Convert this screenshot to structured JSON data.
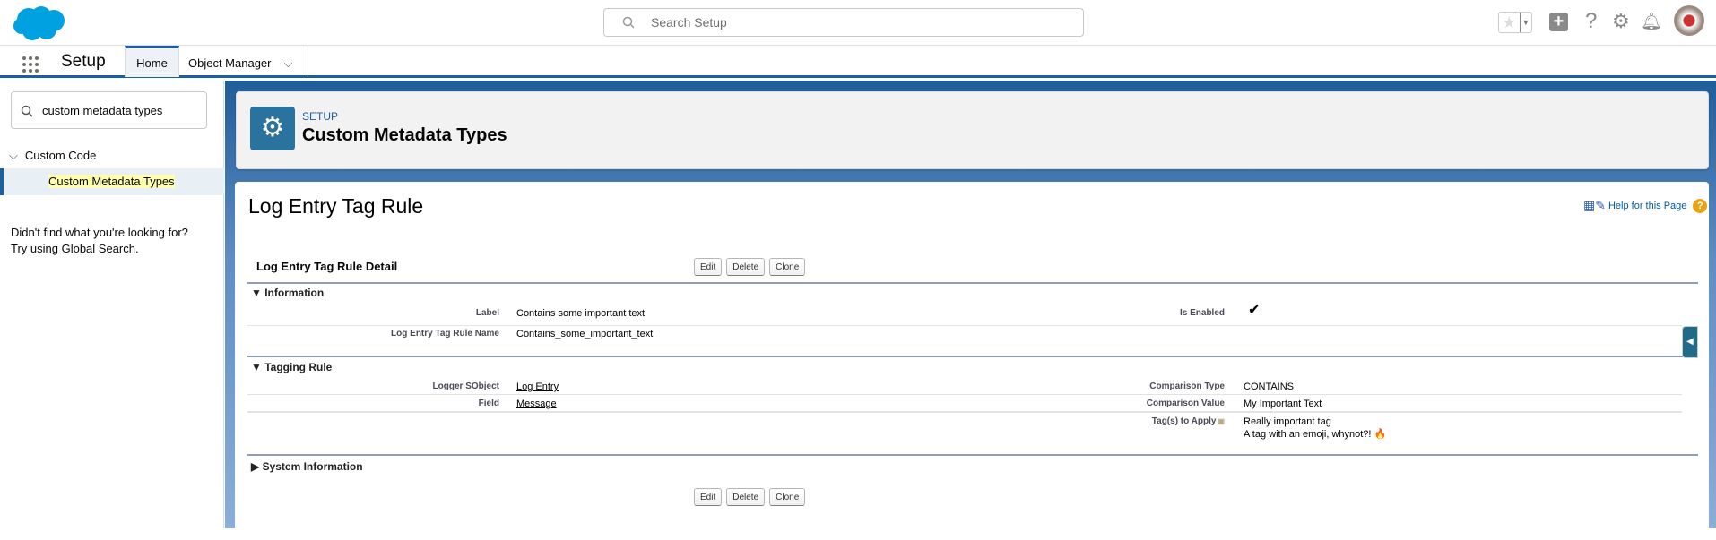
{
  "header": {
    "search_placeholder": "Search Setup",
    "icons": [
      "salesforce-logo",
      "favorites-star-icon",
      "favorites-dropdown-icon",
      "global-create-icon",
      "help-icon",
      "setup-gear-icon",
      "notifications-bell-icon",
      "user-avatar"
    ]
  },
  "nav": {
    "app_name": "Setup",
    "tabs": [
      {
        "label": "Home",
        "active": true
      },
      {
        "label": "Object Manager"
      }
    ]
  },
  "sidebar": {
    "search_value": "custom metadata types",
    "group": "Custom Code",
    "selected_item": "Custom Metadata Types",
    "not_found_line1": "Didn't find what you're looking for?",
    "not_found_line2": "Try using Global Search."
  },
  "page_header": {
    "eyebrow": "SETUP",
    "title": "Custom Metadata Types"
  },
  "record": {
    "title": "Log Entry Tag Rule",
    "help_link": "Help for this Page",
    "detail_title": "Log Entry Tag Rule Detail",
    "buttons": {
      "edit": "Edit",
      "delete": "Delete",
      "clone": "Clone"
    },
    "sections": {
      "information": {
        "title": "Information",
        "label_label": "Label",
        "label_value": "Contains some important text",
        "name_label": "Log Entry Tag Rule Name",
        "name_value": "Contains_some_important_text",
        "enabled_label": "Is Enabled",
        "enabled_value": true
      },
      "tagging": {
        "title": "Tagging Rule",
        "sobject_label": "Logger SObject",
        "sobject_value": "Log Entry",
        "field_label": "Field",
        "field_value": "Message",
        "ctype_label": "Comparison Type",
        "ctype_value": "CONTAINS",
        "cvalue_label": "Comparison Value",
        "cvalue_value": "My Important Text",
        "tags_label": "Tag(s) to Apply",
        "tags": [
          "Really important tag",
          "A tag with an emoji, whynot?! 🔥"
        ]
      },
      "system": {
        "title": "System Information",
        "collapsed": true
      }
    }
  },
  "colors": {
    "brand_blue": "#1b5f9e",
    "icon_tile": "#2a739e",
    "highlight": "#ffffb0"
  }
}
